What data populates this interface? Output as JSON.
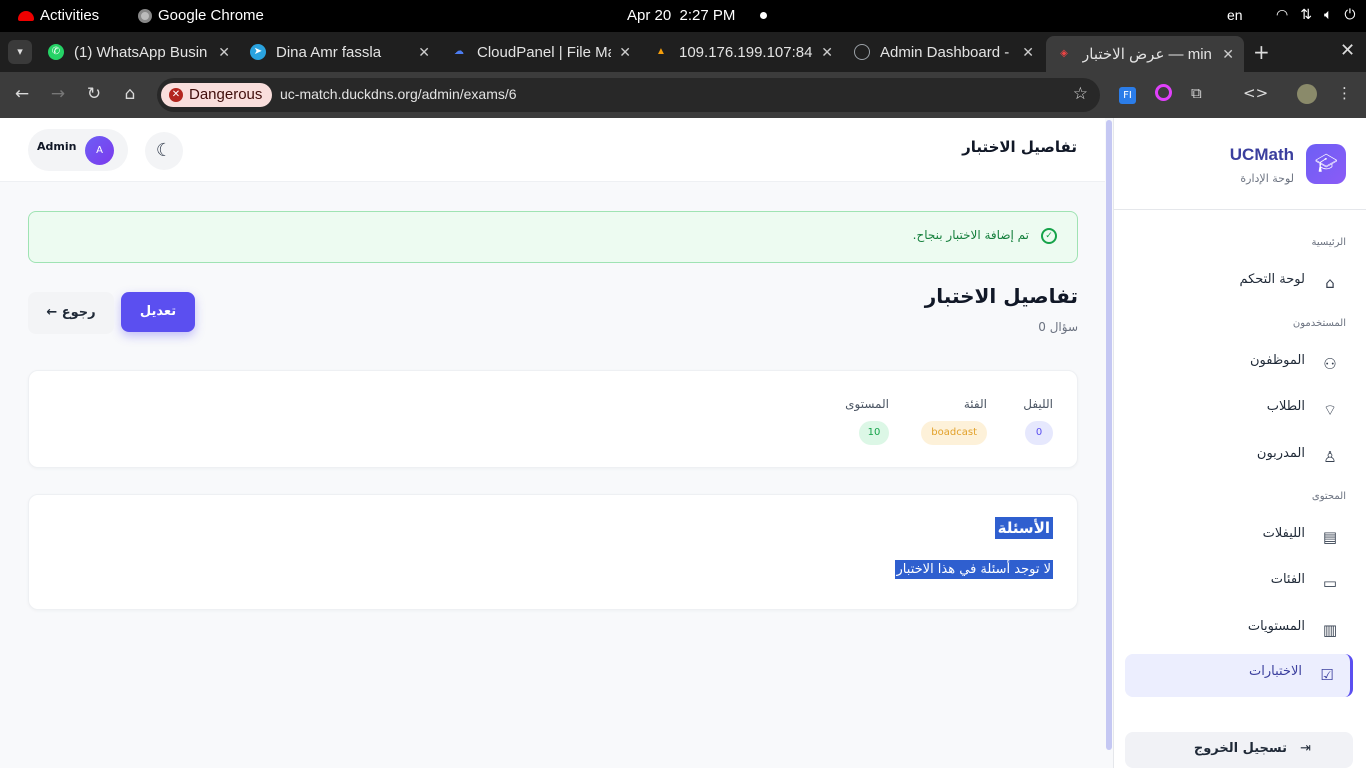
{
  "system": {
    "activities": "Activities",
    "app_name": "Google Chrome",
    "date": "Apr 20",
    "time": "2:27 PM",
    "lang": "en"
  },
  "browser": {
    "tabs": [
      {
        "title": "(1) WhatsApp Busin",
        "icon": "whatsapp-icon",
        "color": "#25d366"
      },
      {
        "title": "Dina Amr fassla",
        "icon": "telegram-icon",
        "color": "#2aa3df"
      },
      {
        "title": "CloudPanel | File Ma",
        "icon": "cloud-icon",
        "color": "#4c7cf0"
      },
      {
        "title": "109.176.199.107:84",
        "icon": "server-icon",
        "color": "#f59e0b"
      },
      {
        "title": "Admin Dashboard -",
        "icon": "globe-icon",
        "color": "#9aa0a6"
      },
      {
        "title": "عرض الاختبار — min",
        "icon": "laravel-icon",
        "color": "#ef4444"
      }
    ],
    "security_label": "Dangerous",
    "url": "uc-match.duckdns.org/admin/exams/6"
  },
  "sidebar": {
    "brand": "UCMath",
    "brand_sub": "لوحة الإدارة",
    "sections": {
      "main": "الرئيسية",
      "users": "المستخدمون",
      "content": "المحتوى"
    },
    "items": {
      "dashboard": "لوحة التحكم",
      "employees": "الموظفون",
      "students": "الطلاب",
      "trainers": "المدربون",
      "files": "الليفلات",
      "categories": "الفئات",
      "levels": "المستويات",
      "exams": "الاختبارات"
    },
    "logout": "تسجيل الخروج"
  },
  "header": {
    "title": "تفاصيل الاختبار",
    "user_name": "Admin",
    "avatar_initial": "A"
  },
  "alert": {
    "message": "تم إضافة الاختبار بنجاح."
  },
  "exam": {
    "title": "تفاصيل الاختبار",
    "question_count": "0 سؤال",
    "edit_label": "تعديل",
    "back_label": "← رجوع",
    "meta": {
      "level_file_label": "الليفل",
      "level_file_value": "0",
      "category_label": "الفئة",
      "category_value": "boadcast",
      "level_label": "المستوى",
      "level_value": "10"
    }
  },
  "questions": {
    "title": "الأسئلة",
    "empty": "لا توجد أسئلة في هذا الاختبار"
  }
}
